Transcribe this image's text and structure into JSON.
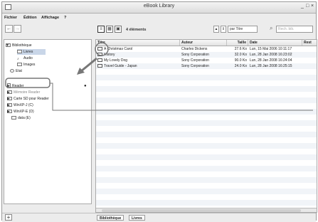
{
  "window": {
    "title": "eBook Library",
    "min_label": "_",
    "max_label": "□",
    "close_label": "×"
  },
  "menu": {
    "items": [
      "Fichier",
      "Édition",
      "Affichage",
      "?"
    ]
  },
  "toolbar": {
    "back_label": "←",
    "forward_label": "→",
    "item_count": "4 éléments",
    "sort_label": "par Titre",
    "search_placeholder": "Rech. bib."
  },
  "sidebar": {
    "items": [
      {
        "label": "Bibliothèque",
        "icon": "library-icon"
      },
      {
        "label": "Livres",
        "icon": "books-icon"
      },
      {
        "label": "Audio",
        "icon": "music-note-icon"
      },
      {
        "label": "Images",
        "icon": "image-icon"
      },
      {
        "label": "Etat",
        "icon": "status-icon"
      },
      {
        "label": "Reader",
        "icon": "reader-device-icon"
      },
      {
        "label": "Mémoire Reader",
        "icon": "memory-icon"
      },
      {
        "label": "Carte SD pour Reader",
        "icon": "sd-card-icon"
      },
      {
        "label": "WinXP-J (C)",
        "icon": "drive-icon"
      },
      {
        "label": "WinXP-E (D)",
        "icon": "drive-icon"
      },
      {
        "label": "data (E)",
        "icon": "drive-icon"
      }
    ]
  },
  "table": {
    "columns": [
      "Titre",
      "Auteur",
      "Taille",
      "Date",
      "Rest"
    ],
    "rows": [
      {
        "title": "A Christmas Carol",
        "author": "Charles Dickens",
        "size": "27.6 Ko",
        "date": "Lun, 15 Mai 2006 10:11:17"
      },
      {
        "title": "History",
        "author": "Sony Corporation",
        "size": "32.0 Ko",
        "date": "Lun, 28 Jan 2008 16:23:02"
      },
      {
        "title": "My Lovely Dog",
        "author": "Sony Corporation",
        "size": "90.0 Ko",
        "date": "Lun, 28 Jan 2008 16:24:04"
      },
      {
        "title": "Travel Guide - Japan",
        "author": "Sony Corporation",
        "size": "24.0 Ko",
        "date": "Lun, 28 Jan 2008 16:25:15"
      }
    ]
  },
  "breadcrumb": {
    "items": [
      "Bibliothèque",
      "Livres"
    ]
  },
  "bottom": {
    "add_label": "+"
  }
}
